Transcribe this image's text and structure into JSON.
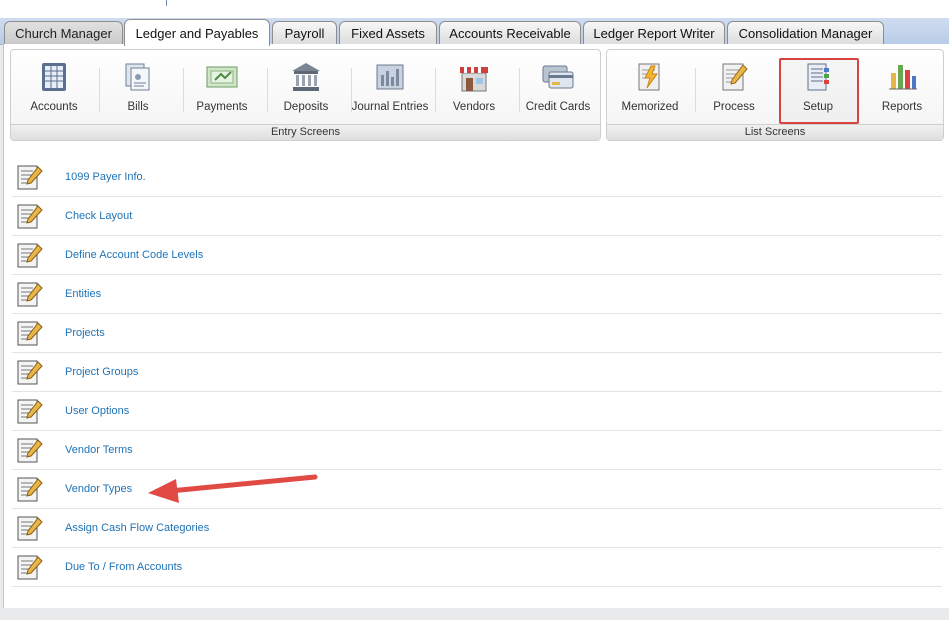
{
  "tabs": [
    {
      "label": "Church Manager"
    },
    {
      "label": "Ledger and Payables"
    },
    {
      "label": "Payroll"
    },
    {
      "label": "Fixed Assets"
    },
    {
      "label": "Accounts Receivable"
    },
    {
      "label": "Ledger Report Writer"
    },
    {
      "label": "Consolidation Manager"
    }
  ],
  "entry_group": {
    "label": "Entry Screens",
    "items": [
      {
        "label": "Accounts",
        "icon": "accounts-icon"
      },
      {
        "label": "Bills",
        "icon": "bills-icon"
      },
      {
        "label": "Payments",
        "icon": "payments-icon"
      },
      {
        "label": "Deposits",
        "icon": "bank-icon"
      },
      {
        "label": "Journal Entries",
        "icon": "journal-icon"
      },
      {
        "label": "Vendors",
        "icon": "store-icon"
      },
      {
        "label": "Credit Cards",
        "icon": "credit-card-icon"
      }
    ]
  },
  "list_group": {
    "label": "List Screens",
    "items": [
      {
        "label": "Memorized",
        "icon": "lightning-doc-icon"
      },
      {
        "label": "Process",
        "icon": "pencil-doc-icon"
      },
      {
        "label": "Setup",
        "icon": "setup-doc-icon"
      },
      {
        "label": "Reports",
        "icon": "bar-chart-icon"
      }
    ]
  },
  "setup_items": [
    {
      "label": "1099 Payer Info."
    },
    {
      "label": "Check Layout"
    },
    {
      "label": "Define Account Code Levels"
    },
    {
      "label": "Entities"
    },
    {
      "label": "Projects"
    },
    {
      "label": "Project Groups"
    },
    {
      "label": "User Options"
    },
    {
      "label": "Vendor Terms"
    },
    {
      "label": "Vendor Types"
    },
    {
      "label": "Assign Cash Flow Categories"
    },
    {
      "label": "Due To / From Accounts"
    }
  ],
  "colors": {
    "link": "#1f73b7",
    "highlight": "#d9433f",
    "arrow": "#e04a43"
  }
}
